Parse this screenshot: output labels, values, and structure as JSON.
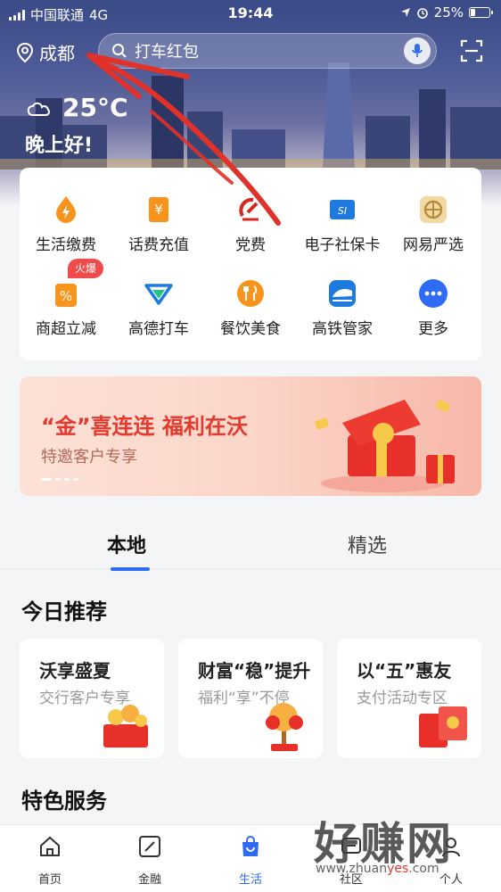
{
  "status_bar": {
    "carrier": "中国联通",
    "network": "4G",
    "time": "19:44",
    "battery": "25%",
    "battery_level": 0.25
  },
  "header": {
    "city": "成都",
    "search_placeholder": "打车红包"
  },
  "weather": {
    "temperature": "25°C",
    "greeting": "晚上好!"
  },
  "services": [
    {
      "label": "生活缴费",
      "icon": "lightning-drop-icon"
    },
    {
      "label": "话费充值",
      "icon": "yuan-receipt-icon"
    },
    {
      "label": "党费",
      "icon": "party-emblem-icon"
    },
    {
      "label": "电子社保卡",
      "icon": "social-security-card-icon"
    },
    {
      "label": "网易严选",
      "icon": "yanxuan-icon"
    },
    {
      "label": "商超立减",
      "icon": "percent-bag-icon",
      "badge": "火爆"
    },
    {
      "label": "高德打车",
      "icon": "amap-icon"
    },
    {
      "label": "餐饮美食",
      "icon": "fork-spoon-icon"
    },
    {
      "label": "高铁管家",
      "icon": "train-icon"
    },
    {
      "label": "更多",
      "icon": "more-dots-icon"
    }
  ],
  "banner": {
    "title": "“金”喜连连 福利在沃",
    "subtitle": "特邀客户专享"
  },
  "tabs": [
    {
      "label": "本地",
      "active": true
    },
    {
      "label": "精选",
      "active": false
    }
  ],
  "today": {
    "title": "今日推荐",
    "cards": [
      {
        "title": "沃享盛夏",
        "subtitle": "交行客户专享"
      },
      {
        "title": "财富“稳”提升",
        "subtitle": "福利“享”不停"
      },
      {
        "title": "以“五”惠友",
        "subtitle": "支付活动专区"
      }
    ]
  },
  "featured": {
    "title": "特色服务"
  },
  "bottom_nav": [
    {
      "label": "首页",
      "icon": "home-icon",
      "active": false
    },
    {
      "label": "金融",
      "icon": "finance-icon",
      "active": false
    },
    {
      "label": "生活",
      "icon": "shopping-bag-icon",
      "active": true
    },
    {
      "label": "社区",
      "icon": "community-icon",
      "active": false
    },
    {
      "label": "个人",
      "icon": "person-icon",
      "active": false
    }
  ],
  "watermark": {
    "text": "好赚网",
    "url_prefix": "www.zhuan",
    "url_accent": "yes",
    "url_suffix": ".com"
  },
  "colors": {
    "accent": "#2f6bf6",
    "banner_red": "#e23a2e",
    "badge_red": "#f04b4b"
  }
}
